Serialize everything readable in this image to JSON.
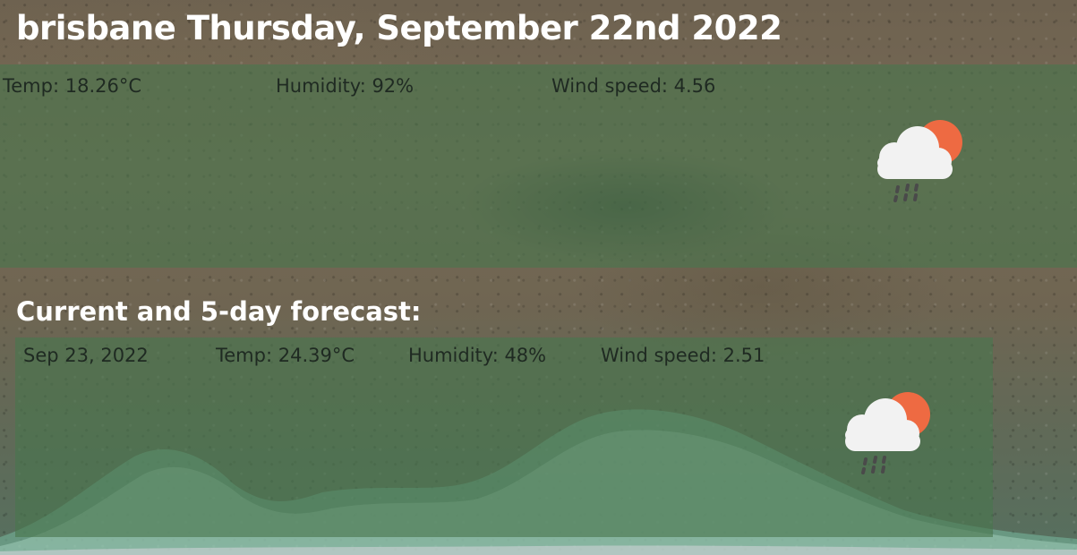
{
  "header": {
    "city": "brisbane",
    "date": "Thursday, September 22nd 2022"
  },
  "current": {
    "temp": "Temp: 18.26°C",
    "humidity": "Humidity: 92%",
    "wind": "Wind speed: 4.56",
    "icon": "partly-cloudy-rain-icon"
  },
  "forecast": {
    "heading": "Current and 5-day forecast:",
    "days": [
      {
        "date": "Sep 23, 2022",
        "temp": "Temp: 24.39°C",
        "humidity": "Humidity: 48%",
        "wind": "Wind speed: 2.51",
        "icon": "partly-cloudy-rain-icon"
      }
    ]
  },
  "colors": {
    "panel": "#48764e",
    "title_text": "#ffffff",
    "stat_text": "#1f2a22",
    "sun": "#ee6a42",
    "cloud": "#f2f2f2",
    "rain": "#4a4a4a"
  }
}
